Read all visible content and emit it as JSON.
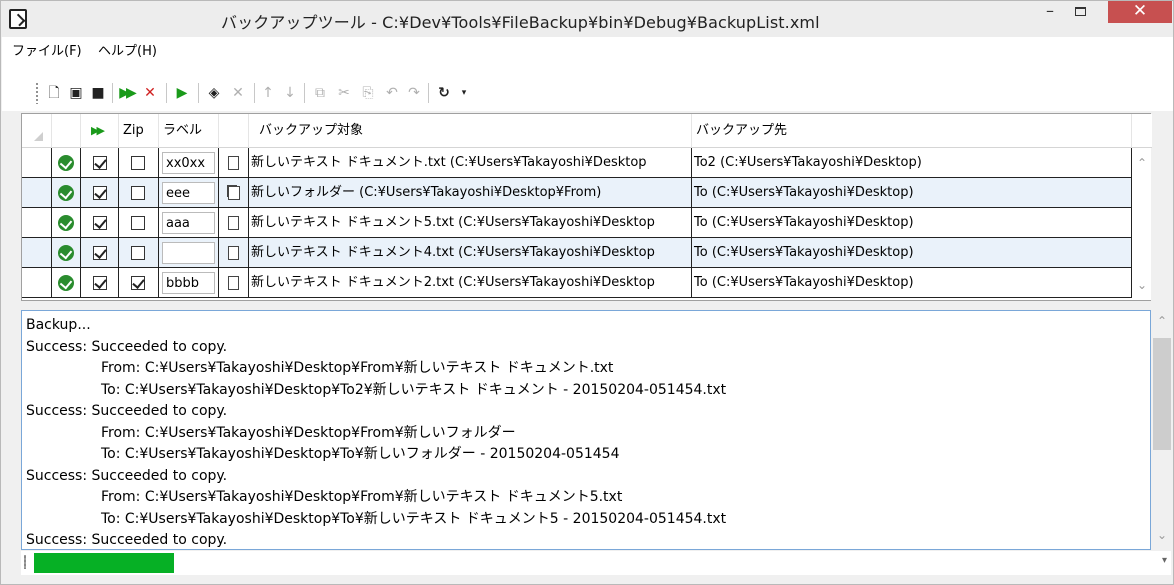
{
  "window": {
    "title": "バックアップツール - C:¥Dev¥Tools¥FileBackup¥bin¥Debug¥BackupList.xml",
    "minimize": "–",
    "close": "✕"
  },
  "menu": {
    "file": "ファイル(F)",
    "help": "ヘルプ(H)"
  },
  "toolbar": {
    "icons": [
      "new-icon",
      "open-icon",
      "save-icon",
      "run-all-icon",
      "delete-icon",
      "run-icon",
      "add-icon",
      "remove-icon",
      "move-up-icon",
      "move-down-icon",
      "copy-icon",
      "cut-icon",
      "paste-icon",
      "undo-icon",
      "redo-icon",
      "refresh-icon"
    ]
  },
  "grid": {
    "headers": {
      "run": "▶▶",
      "zip": "Zip",
      "label": "ラベル",
      "source": "バックアップ対象",
      "dest": "バックアップ先"
    },
    "rows": [
      {
        "checked": true,
        "zip": false,
        "label": "xx0xx",
        "type": "file",
        "source": "新しいテキスト ドキュメント.txt (C:¥Users¥Takayoshi¥Desktop",
        "dest": "To2 (C:¥Users¥Takayoshi¥Desktop)"
      },
      {
        "checked": true,
        "zip": false,
        "label": "eee",
        "type": "folder",
        "source": "新しいフォルダー (C:¥Users¥Takayoshi¥Desktop¥From)",
        "dest": "To (C:¥Users¥Takayoshi¥Desktop)"
      },
      {
        "checked": true,
        "zip": false,
        "label": "aaa",
        "type": "file",
        "source": "新しいテキスト ドキュメント5.txt (C:¥Users¥Takayoshi¥Desktop",
        "dest": "To (C:¥Users¥Takayoshi¥Desktop)"
      },
      {
        "checked": true,
        "zip": false,
        "label": "",
        "type": "file",
        "source": "新しいテキスト ドキュメント4.txt (C:¥Users¥Takayoshi¥Desktop",
        "dest": "To (C:¥Users¥Takayoshi¥Desktop)"
      },
      {
        "checked": true,
        "zip": true,
        "label": "bbbb",
        "type": "file",
        "source": "新しいテキスト ドキュメント2.txt (C:¥Users¥Takayoshi¥Desktop",
        "dest": "To (C:¥Users¥Takayoshi¥Desktop)"
      }
    ]
  },
  "log": {
    "lines": [
      {
        "indent": false,
        "text": "Backup..."
      },
      {
        "indent": false,
        "text": "Success: Succeeded to copy."
      },
      {
        "indent": true,
        "text": "From: C:¥Users¥Takayoshi¥Desktop¥From¥新しいテキスト ドキュメント.txt"
      },
      {
        "indent": true,
        "text": "To: C:¥Users¥Takayoshi¥Desktop¥To2¥新しいテキスト ドキュメント - 20150204-051454.txt"
      },
      {
        "indent": false,
        "text": "Success: Succeeded to copy."
      },
      {
        "indent": true,
        "text": "From: C:¥Users¥Takayoshi¥Desktop¥From¥新しいフォルダー"
      },
      {
        "indent": true,
        "text": "To: C:¥Users¥Takayoshi¥Desktop¥To¥新しいフォルダー - 20150204-051454"
      },
      {
        "indent": false,
        "text": "Success: Succeeded to copy."
      },
      {
        "indent": true,
        "text": "From: C:¥Users¥Takayoshi¥Desktop¥From¥新しいテキスト ドキュメント5.txt"
      },
      {
        "indent": true,
        "text": "To: C:¥Users¥Takayoshi¥Desktop¥To¥新しいテキスト ドキュメント5 - 20150204-051454.txt"
      },
      {
        "indent": false,
        "text": "Success: Succeeded to copy."
      }
    ]
  },
  "status": {
    "progress": 1.0,
    "progress_color": "#06b025"
  }
}
